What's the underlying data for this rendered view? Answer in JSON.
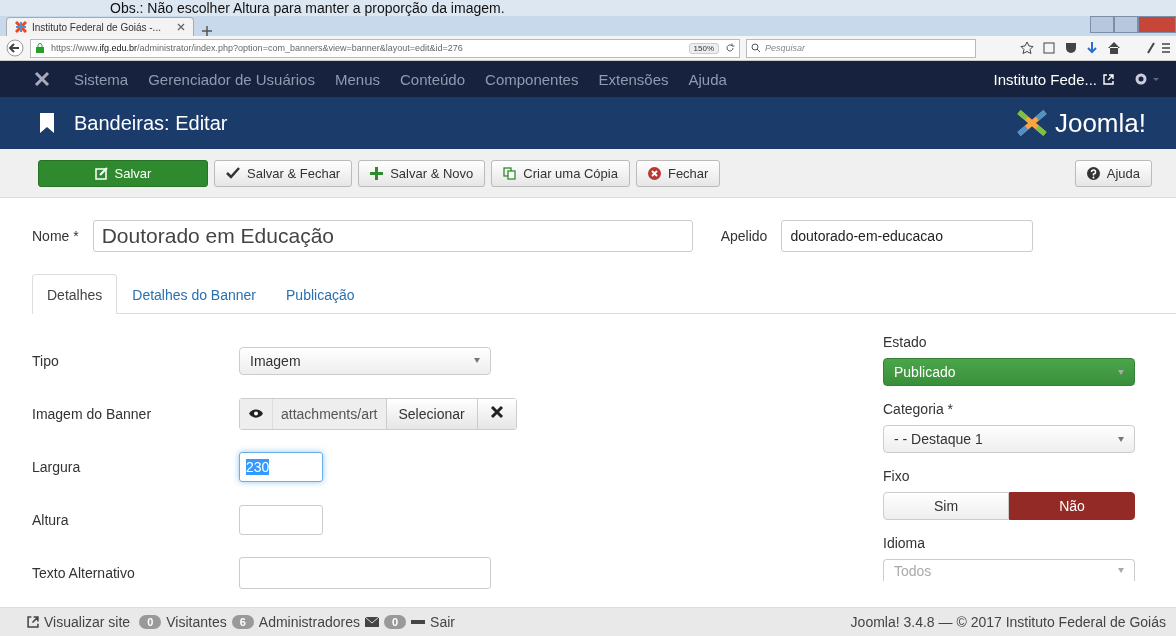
{
  "caption": "Obs.: Não escolher Altura para manter a proporção da imagem.",
  "browser": {
    "tab_title": "Instituto Federal de Goiás -...",
    "url_prefix": "https://www.",
    "url_host": "ifg.edu.br",
    "url_path": "/administrator/index.php?option=com_banners&view=banner&layout=edit&id=276",
    "zoom": "150%",
    "search_placeholder": "Pesquisar"
  },
  "nav": {
    "items": [
      "Sistema",
      "Gerenciador de Usuários",
      "Menus",
      "Conteúdo",
      "Componentes",
      "Extensões",
      "Ajuda"
    ],
    "site": "Instituto Fede..."
  },
  "header": {
    "title": "Bandeiras: Editar",
    "brand": "Joomla!"
  },
  "toolbar": [
    {
      "label": "Salvar",
      "kind": "save"
    },
    {
      "label": "Salvar & Fechar",
      "kind": "save-close"
    },
    {
      "label": "Salvar & Novo",
      "kind": "save-new"
    },
    {
      "label": "Criar uma Cópia",
      "kind": "copy"
    },
    {
      "label": "Fechar",
      "kind": "close"
    }
  ],
  "help": "Ajuda",
  "name": {
    "label": "Nome *",
    "value": "Doutorado em Educação"
  },
  "alias": {
    "label": "Apelido",
    "value": "doutorado-em-educacao"
  },
  "tabs": [
    {
      "label": "Detalhes",
      "selected": true
    },
    {
      "label": "Detalhes do Banner",
      "selected": false
    },
    {
      "label": "Publicação",
      "selected": false
    }
  ],
  "fields": [
    {
      "label": "Tipo",
      "kind": "select",
      "value": "Imagem"
    },
    {
      "label": "Imagem do Banner",
      "kind": "media",
      "value": "attachments/art",
      "button": "Selecionar"
    },
    {
      "label": "Largura",
      "kind": "short-active",
      "value": "230"
    },
    {
      "label": "Altura",
      "kind": "short"
    },
    {
      "label": "Texto Alternativo",
      "kind": "text"
    }
  ],
  "side": [
    {
      "label": "Estado",
      "kind": "status",
      "value": "Publicado"
    },
    {
      "label": "Categoria *",
      "kind": "select",
      "value": "- - Destaque 1"
    },
    {
      "label": "Fixo",
      "kind": "toggle",
      "options": [
        {
          "label": "Sim",
          "selected": false
        },
        {
          "label": "Não",
          "selected": true
        }
      ]
    },
    {
      "label": "Idioma",
      "kind": "select-disabled",
      "value": "Todos"
    }
  ],
  "footer": {
    "view_site": "Visualizar site",
    "visitors_count": "0",
    "visitors": "Visitantes",
    "admins_count": "6",
    "admins": "Administradores",
    "messages_count": "0",
    "logout": "Sair",
    "copyright": "Joomla! 3.4.8 — © 2017 Instituto Federal de Goiás"
  }
}
